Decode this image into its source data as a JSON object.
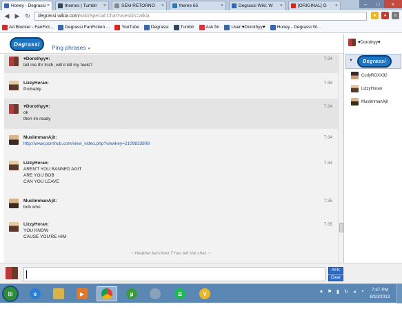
{
  "browser": {
    "tabs": [
      {
        "label": "Honey - Degrassi",
        "active": true,
        "favicon_color": "#3a66b0"
      },
      {
        "label": "themes | Tumblr",
        "active": false,
        "favicon_color": "#35465c"
      },
      {
        "label": "SEM-RETORNO",
        "active": false,
        "favicon_color": "#888888"
      },
      {
        "label": "theme 65",
        "active": false,
        "favicon_color": "#2a7ab8"
      },
      {
        "label": "Degrassi Wiki: W",
        "active": false,
        "favicon_color": "#3a66b0"
      },
      {
        "label": "[ORIGINAL] O",
        "active": false,
        "favicon_color": "#d9251d"
      }
    ],
    "url_host": "degrassi.wikia.com",
    "url_path": "/wiki/Special:Chat?useskin=wikia",
    "bookmarks": [
      {
        "label": "Ad Blocker - FanFict...",
        "icon_color": "#d12b2b"
      },
      {
        "label": "Degrassi FanFiction ...",
        "icon_color": "#3a66b0"
      },
      {
        "label": "YouTube",
        "icon_color": "#d9251d"
      },
      {
        "label": "Degrassi",
        "icon_color": "#3a66b0"
      },
      {
        "label": "Tumblr",
        "icon_color": "#35465c"
      },
      {
        "label": "Ask.fm",
        "icon_color": "#e0313a"
      },
      {
        "label": "User:♥Dorothyy♥",
        "icon_color": "#3a66b0"
      },
      {
        "label": "Honey - Degrassi W...",
        "icon_color": "#3a66b0"
      }
    ]
  },
  "chat": {
    "logo_text": "Degrassi",
    "ping_phrases_label": "Ping phrases",
    "system_message": "~ Heather.kershner.7 has left the chat. ~",
    "messages": [
      {
        "user": "♥Dorothyy♥:",
        "time": "7:34",
        "lines": [
          "tell me thr truth, will it kill my feels?"
        ],
        "avatar": "dorothyy"
      },
      {
        "user": "LizzyHoran:",
        "time": "7:34",
        "lines": [
          "Probably"
        ],
        "avatar": "lizzy"
      },
      {
        "user": "♥Dorothyy♥:",
        "time": "7:34",
        "lines": [
          "ok",
          "then im ready"
        ],
        "avatar": "dorothyy"
      },
      {
        "user": "MuslimmanAjit:",
        "time": "7:34",
        "lines": [
          "http://www.pornhub.com/view_video.php?viewkey=2109833808"
        ],
        "avatar": "muslim",
        "link": true
      },
      {
        "user": "LizzyHoran:",
        "time": "7:34",
        "lines": [
          "AREN'T YOU BANNED AGIT",
          "ARE YOU BOB",
          "CAN YOU LEAVE"
        ],
        "avatar": "lizzy"
      },
      {
        "user": "MuslimmanAjit:",
        "time": "7:35",
        "lines": [
          "bob who"
        ],
        "avatar": "muslim"
      },
      {
        "user": "LizzyHoran:",
        "time": "7:35",
        "lines": [
          "YOU KNOW",
          "CAUSE YOU'RE HIM"
        ],
        "avatar": "lizzy"
      }
    ],
    "afk_label": "AFK",
    "clear_label": "Clear"
  },
  "sidebar": {
    "me": "♥Dorothyy♥",
    "users": [
      {
        "name": "CurlyROXX92",
        "avatar": "curly"
      },
      {
        "name": "LizzyHoran",
        "avatar": "lizzy"
      },
      {
        "name": "MuslimmanAjit",
        "avatar": "muslim"
      }
    ]
  },
  "taskbar": {
    "time": "7:37 PM",
    "date": "8/10/2013"
  }
}
